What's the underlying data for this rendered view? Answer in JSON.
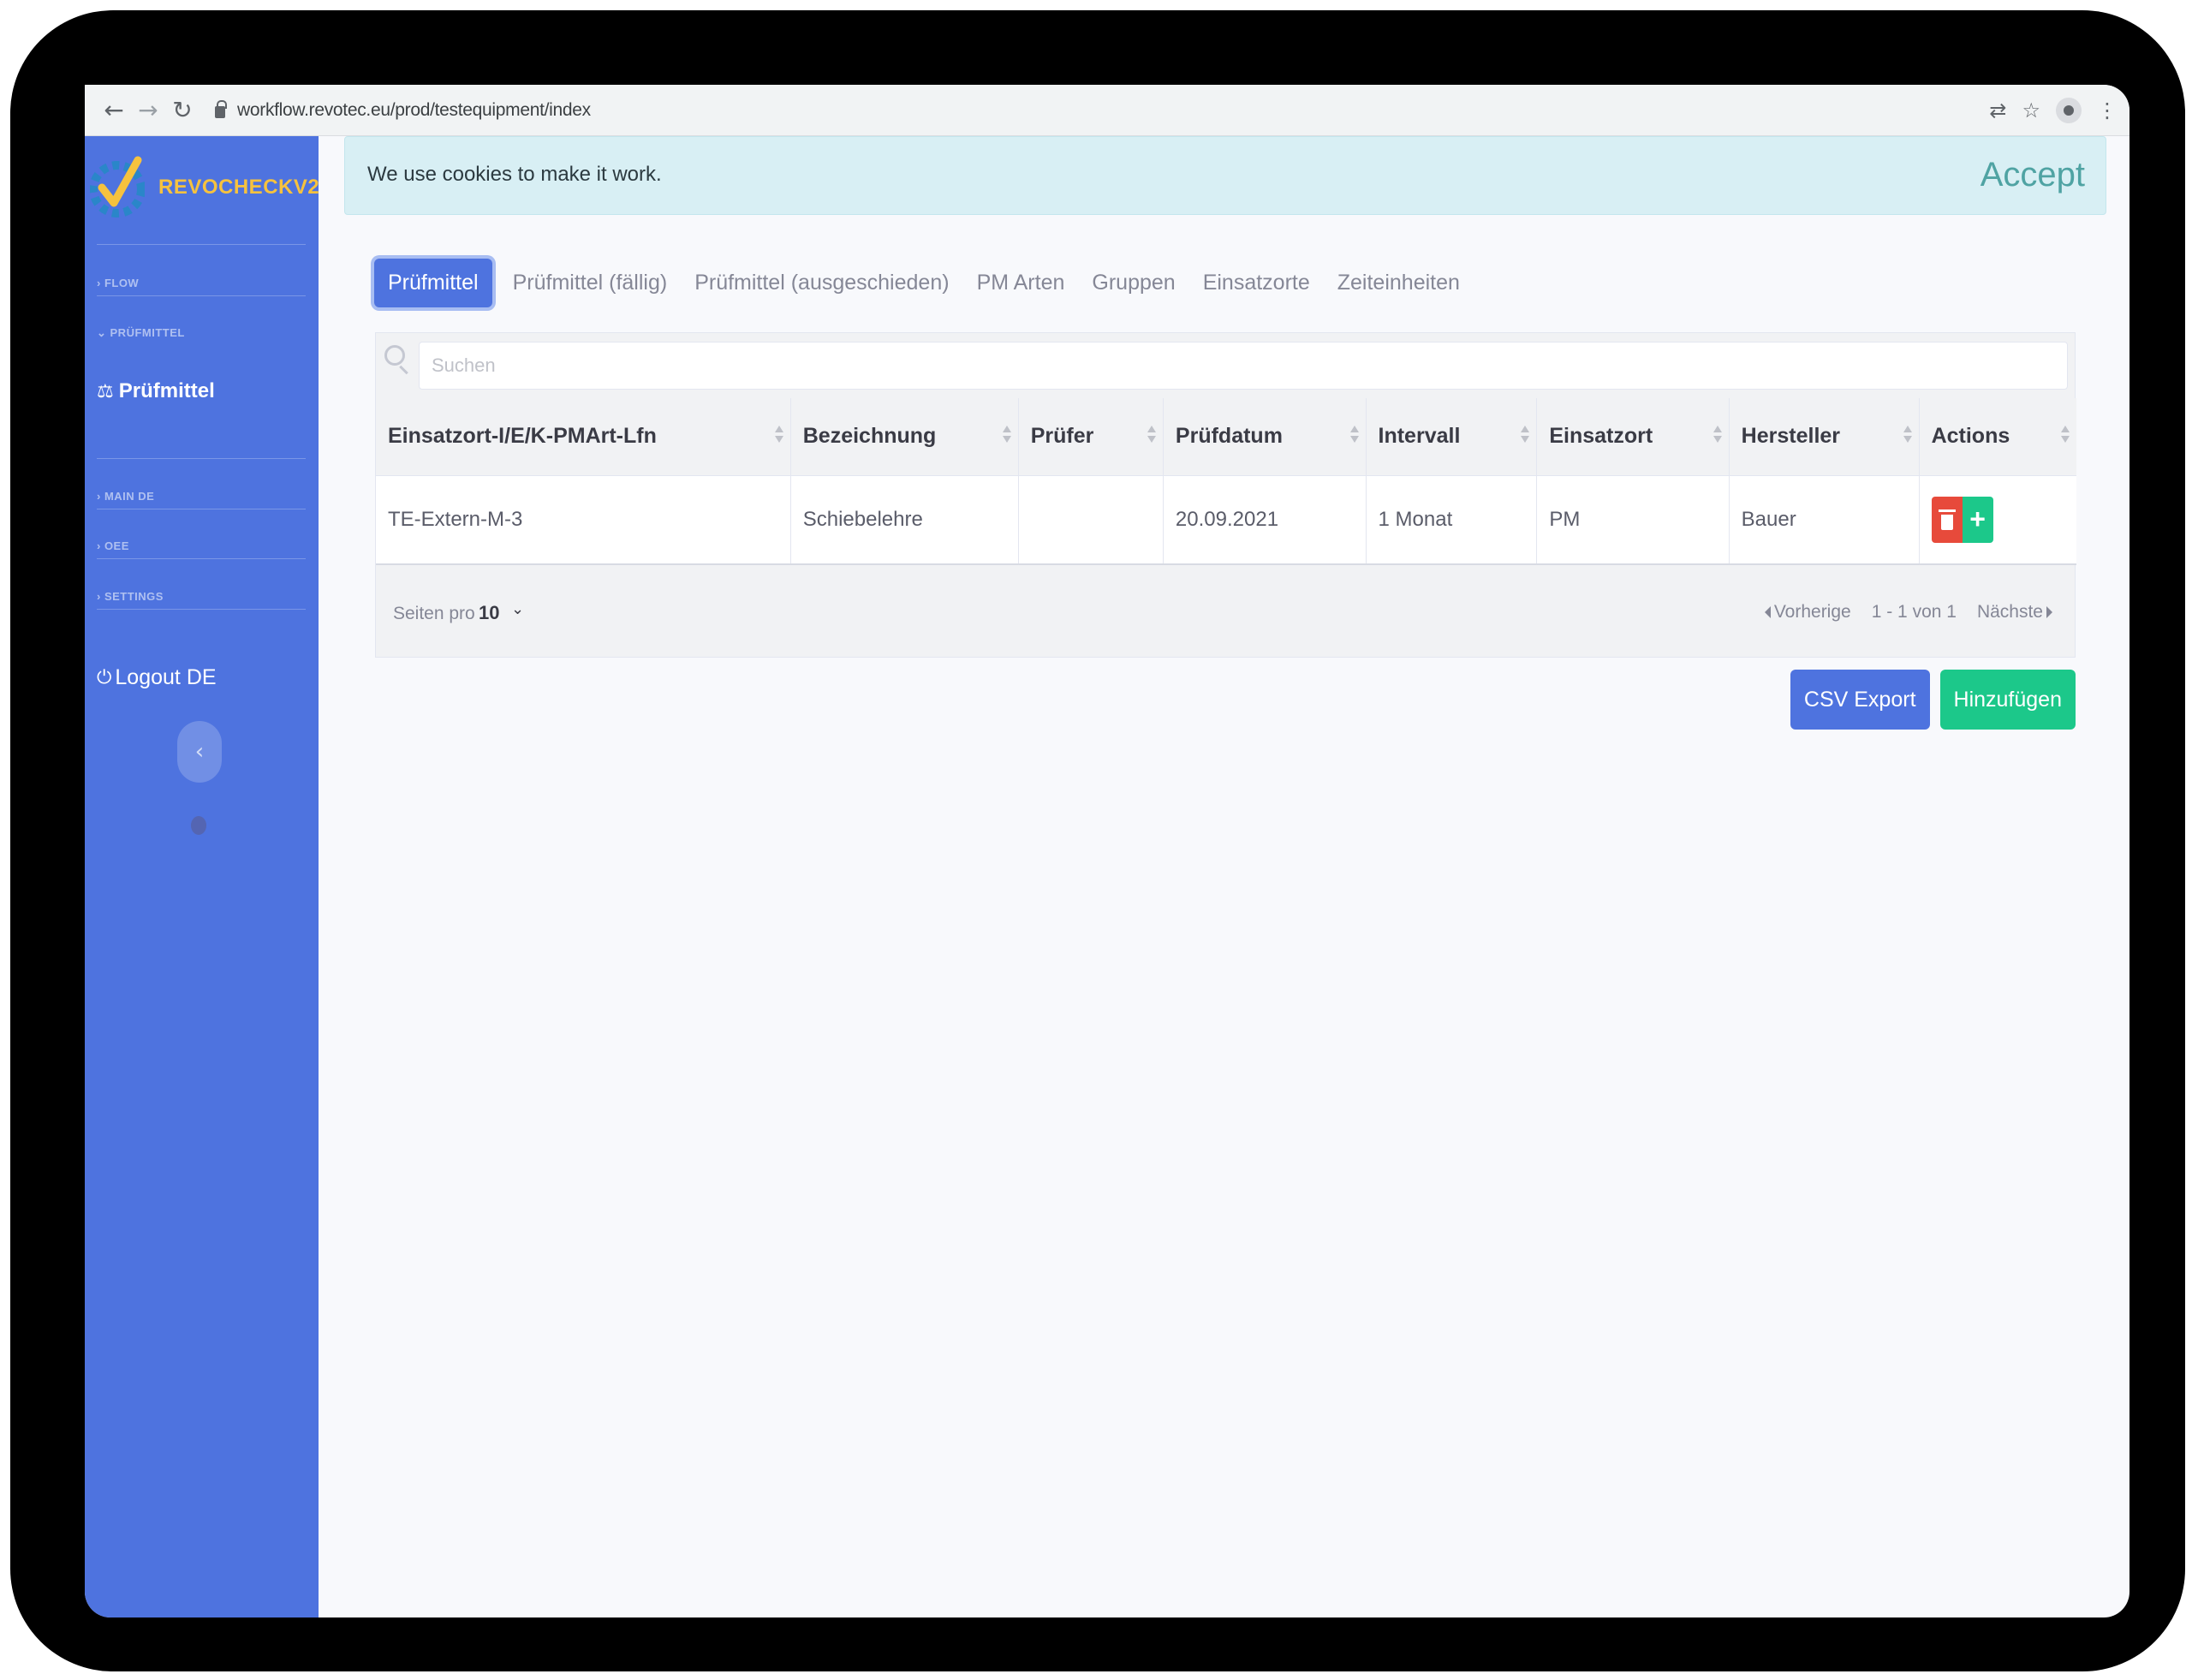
{
  "browser": {
    "url": "workflow.revotec.eu/prod/testequipment/index"
  },
  "sidebar": {
    "brand": "REVOCHECKV2",
    "sections": [
      {
        "label": "› FLOW"
      },
      {
        "label": "⌄ PRÜFMITTEL"
      },
      {
        "label": "› MAIN DE"
      },
      {
        "label": "› OEE"
      },
      {
        "label": "› SETTINGS"
      }
    ],
    "active_item": "Prüfmittel",
    "logout": "Logout DE"
  },
  "cookie": {
    "text": "We use cookies to make it work.",
    "accept": "Accept"
  },
  "tabs": [
    {
      "label": "Prüfmittel",
      "active": true
    },
    {
      "label": "Prüfmittel (fällig)"
    },
    {
      "label": "Prüfmittel (ausgeschieden)"
    },
    {
      "label": "PM Arten"
    },
    {
      "label": "Gruppen"
    },
    {
      "label": "Einsatzorte"
    },
    {
      "label": "Zeiteinheiten"
    }
  ],
  "search": {
    "placeholder": "Suchen"
  },
  "table": {
    "columns": [
      "Einsatzort-I/E/K-PMArt-Lfn",
      "Bezeichnung",
      "Prüfer",
      "Prüfdatum",
      "Intervall",
      "Einsatzort",
      "Hersteller",
      "Actions"
    ],
    "rows": [
      [
        "TE-Extern-M-3",
        "Schiebelehre",
        "",
        "20.09.2021",
        "1 Monat",
        "PM",
        "Bauer"
      ]
    ]
  },
  "pager": {
    "per_page_label": "Seiten pro",
    "per_page_value": "10",
    "prev": "Vorherige",
    "range": "1 - 1 von 1",
    "next": "Nächste"
  },
  "buttons": {
    "csv_export": "CSV Export",
    "add": "Hinzufügen"
  },
  "colors": {
    "sidebar": "#4e73df",
    "brand": "#f6c23e",
    "danger": "#e74a3b",
    "success": "#1cc88a",
    "cookie_bg": "#d8eff4"
  }
}
